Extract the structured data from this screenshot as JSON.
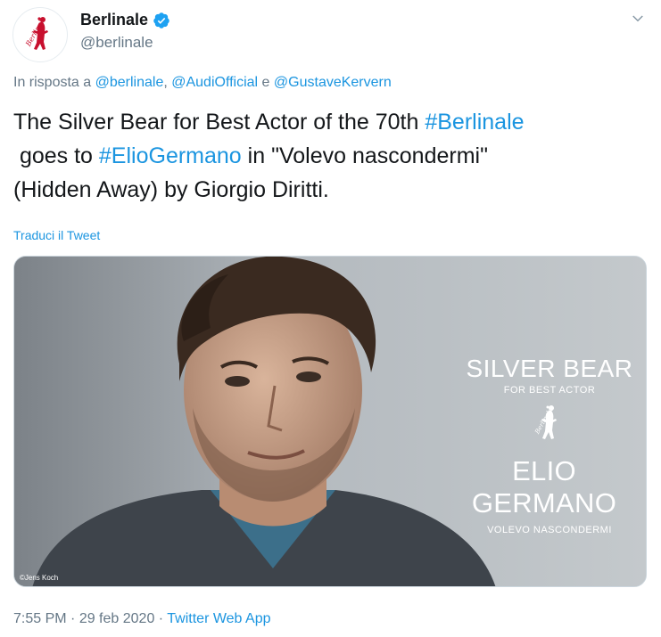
{
  "author": {
    "display_name": "Berlinale",
    "handle": "@berlinale",
    "verified_icon": "verified-badge-icon",
    "avatar_text": "Berlinale"
  },
  "reply": {
    "prefix": "In risposta a ",
    "mention1": "@berlinale",
    "sep1": ", ",
    "mention2": "@AudiOfficial",
    "sep2": " e ",
    "mention3": "@GustaveKervern"
  },
  "tweet": {
    "part1": "The Silver Bear for Best Actor of the 70th ",
    "hashtag1": "#Berlinale",
    "part2": " goes to ",
    "hashtag2": "#ElioGermano",
    "part3": " in \"Volevo nascondermi\"",
    "part4": "(Hidden Away) by Giorgio Diritti."
  },
  "translate_label": "Traduci il Tweet",
  "media": {
    "title": "SILVER BEAR",
    "subtitle": "FOR BEST ACTOR",
    "bear_text": "Berlinale",
    "actor": "ELIO GERMANO",
    "film": "VOLEVO NASCONDERMI",
    "credit": "©Jens Koch"
  },
  "meta": {
    "time": "7:55 PM",
    "dot1": " · ",
    "date": "29 feb 2020",
    "dot2": " · ",
    "app": "Twitter Web App"
  },
  "colors": {
    "link": "#1b95e0",
    "brand_red": "#c8102e",
    "muted": "#657786"
  }
}
